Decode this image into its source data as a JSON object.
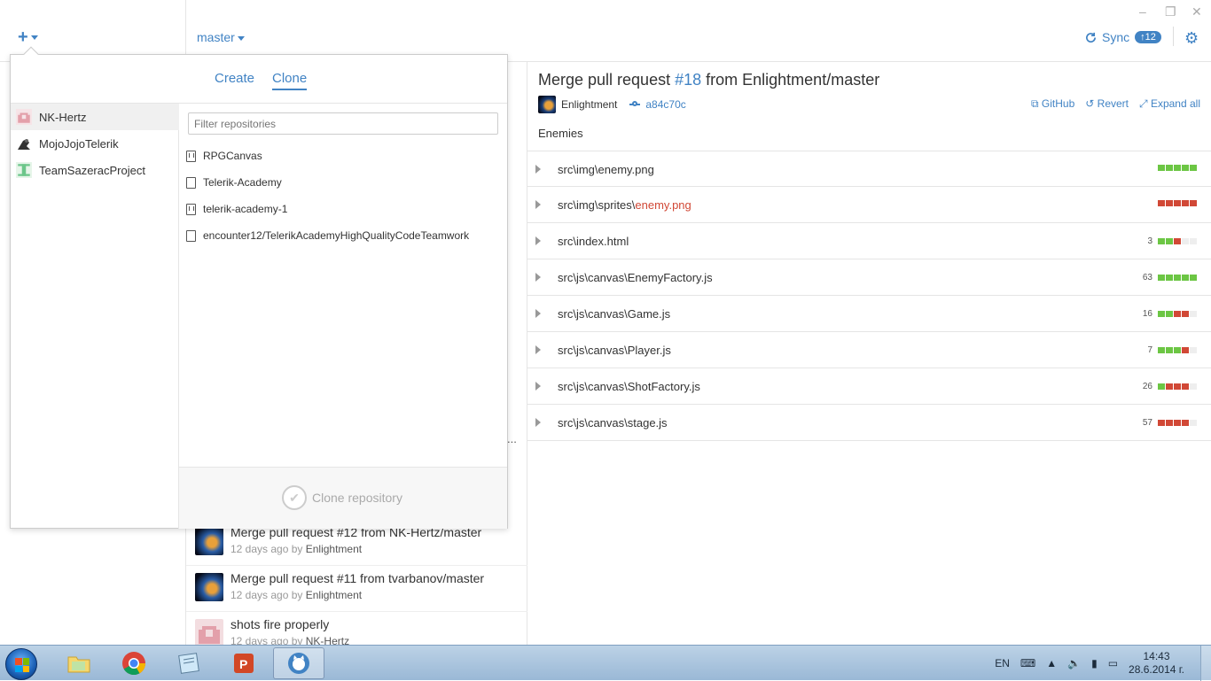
{
  "toolbar": {
    "add_icon": "plus-icon",
    "branch": "master",
    "sync_label": "Sync",
    "sync_badge": "↑12",
    "settings_icon": "gear-icon",
    "window_controls": [
      "–",
      "❐",
      "✕"
    ]
  },
  "history": {
    "items": [
      {
        "title": "Merge pull request #12 from NK-Hertz/master",
        "meta_prefix": "12 days ago by ",
        "author": "Enlightment"
      },
      {
        "title": "Merge pull request #11 from tvarbanov/master",
        "meta_prefix": "12 days ago by ",
        "author": "Enlightment"
      },
      {
        "title": "shots fire properly",
        "meta_prefix": "12 days ago by ",
        "author": "NK-Hertz"
      }
    ],
    "truncated_ellipsis": "..."
  },
  "commit": {
    "title_prefix": "Merge pull request ",
    "pr": "#18",
    "title_suffix": " from Enlightment/master",
    "author": "Enlightment",
    "sha": "a84c70c",
    "actions": {
      "github": "GitHub",
      "revert": "Revert",
      "expand": "Expand all"
    },
    "description": "Enemies",
    "files": [
      {
        "dir": "src\\img\\",
        "name": "enemy.png",
        "deleted": false,
        "count": "",
        "blocks": [
          "g",
          "g",
          "g",
          "g",
          "g"
        ]
      },
      {
        "dir": "src\\img\\sprites\\",
        "name": "enemy.png",
        "deleted": true,
        "count": "",
        "blocks": [
          "r",
          "r",
          "r",
          "r",
          "r"
        ]
      },
      {
        "dir": "src\\",
        "name": "index.html",
        "deleted": false,
        "count": "3",
        "blocks": [
          "g",
          "g",
          "r",
          "e",
          "e"
        ]
      },
      {
        "dir": "src\\js\\canvas\\",
        "name": "EnemyFactory.js",
        "deleted": false,
        "count": "63",
        "blocks": [
          "g",
          "g",
          "g",
          "g",
          "g"
        ]
      },
      {
        "dir": "src\\js\\canvas\\",
        "name": "Game.js",
        "deleted": false,
        "count": "16",
        "blocks": [
          "g",
          "g",
          "r",
          "r",
          "e"
        ]
      },
      {
        "dir": "src\\js\\canvas\\",
        "name": "Player.js",
        "deleted": false,
        "count": "7",
        "blocks": [
          "g",
          "g",
          "g",
          "r",
          "e"
        ]
      },
      {
        "dir": "src\\js\\canvas\\",
        "name": "ShotFactory.js",
        "deleted": false,
        "count": "26",
        "blocks": [
          "g",
          "r",
          "r",
          "r",
          "e"
        ]
      },
      {
        "dir": "src\\js\\canvas\\",
        "name": "stage.js",
        "deleted": false,
        "count": "57",
        "blocks": [
          "r",
          "r",
          "r",
          "r",
          "e"
        ]
      }
    ]
  },
  "popover": {
    "tabs": {
      "create": "Create",
      "clone": "Clone"
    },
    "accounts": [
      "NK-Hertz",
      "MojoJojoTelerik",
      "TeamSazeracProject"
    ],
    "filter_placeholder": "Filter repositories",
    "repos": [
      {
        "name": "RPGCanvas",
        "type": "fork"
      },
      {
        "name": "Telerik-Academy",
        "type": "repo"
      },
      {
        "name": "telerik-academy-1",
        "type": "fork"
      },
      {
        "name": "encounter12/TelerikAcademyHighQualityCodeTeamwork",
        "type": "repo"
      }
    ],
    "clone_button": "Clone repository"
  },
  "taskbar": {
    "language": "EN",
    "time": "14:43",
    "date": "28.6.2014 г."
  },
  "colors": {
    "accent": "#4183c4",
    "added": "#6cc644",
    "deleted": "#d14836"
  }
}
